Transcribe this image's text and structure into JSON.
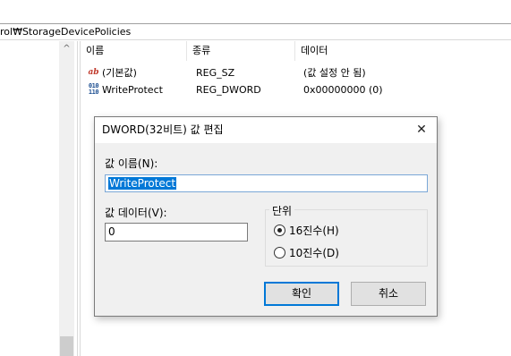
{
  "address": {
    "path": "rol₩StorageDevicePolicies"
  },
  "list": {
    "columns": [
      "이름",
      "종류",
      "데이터"
    ],
    "rows": [
      {
        "icon": "string-value-icon",
        "icon_text": "ab",
        "name": "(기본값)",
        "type": "REG_SZ",
        "data": "(값 설정 안 됨)"
      },
      {
        "icon": "binary-value-icon",
        "icon_text": "010\n110",
        "name": "WriteProtect",
        "type": "REG_DWORD",
        "data": "0x00000000 (0)"
      }
    ]
  },
  "tree": {
    "scroll_up_glyph": "^"
  },
  "dialog": {
    "title": "DWORD(32비트) 값 편집",
    "close_glyph": "✕",
    "name_label": "값 이름(N):",
    "name_value": "WriteProtect",
    "data_label": "값 데이터(V):",
    "data_value": "0",
    "unit_label": "단위",
    "radios": [
      {
        "label": "16진수(H)",
        "checked": true
      },
      {
        "label": "10진수(D)",
        "checked": false
      }
    ],
    "ok_label": "확인",
    "cancel_label": "취소"
  }
}
